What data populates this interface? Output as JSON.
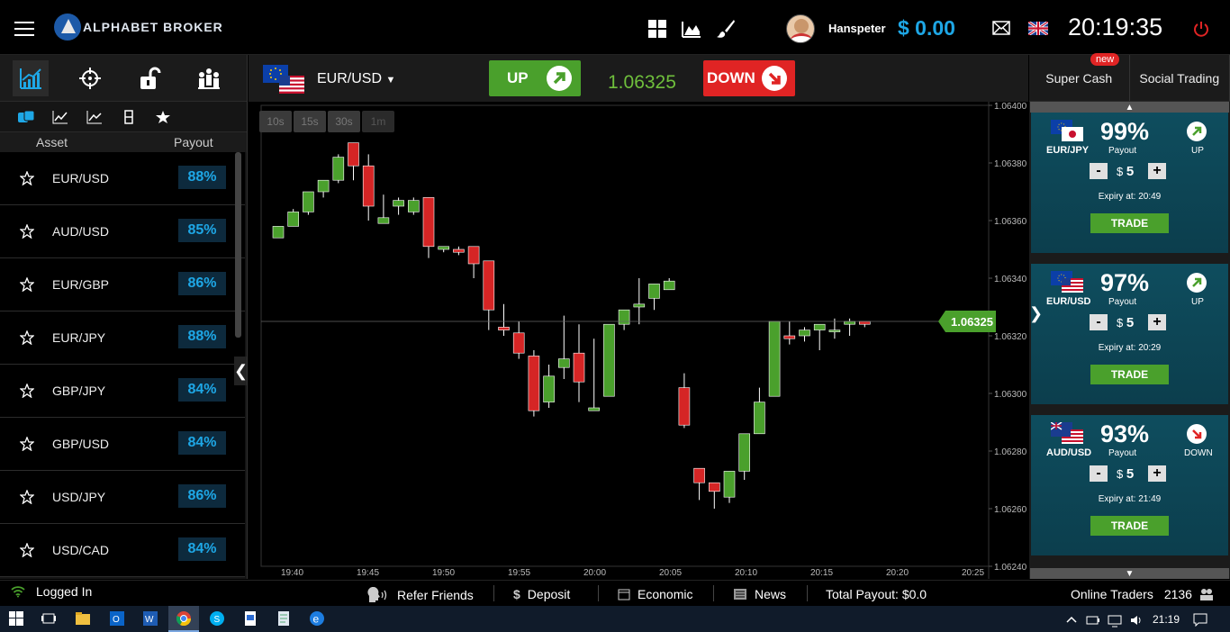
{
  "header": {
    "logo_text": "ALPHABET BROKER",
    "username": "Hanspeter",
    "balance": "$ 0.00",
    "clock": "20:19:35",
    "icons": [
      "menu-icon",
      "grid-icon",
      "area-chart-icon",
      "brush-icon",
      "mail-icon",
      "uk-flag-icon",
      "power-icon"
    ]
  },
  "left": {
    "col_asset": "Asset",
    "col_payout": "Payout",
    "assets": [
      {
        "name": "EUR/USD",
        "payout": "88%"
      },
      {
        "name": "AUD/USD",
        "payout": "85%"
      },
      {
        "name": "EUR/GBP",
        "payout": "86%"
      },
      {
        "name": "EUR/JPY",
        "payout": "88%"
      },
      {
        "name": "GBP/JPY",
        "payout": "84%"
      },
      {
        "name": "GBP/USD",
        "payout": "84%"
      },
      {
        "name": "USD/JPY",
        "payout": "86%"
      },
      {
        "name": "USD/CAD",
        "payout": "84%"
      }
    ],
    "collapse_glyph": "❮"
  },
  "center": {
    "pair": "EUR/USD",
    "up_label": "UP",
    "price": "1.06325",
    "down_label": "DOWN",
    "intervals": [
      "10s",
      "15s",
      "30s",
      "1m"
    ],
    "current_price_tag": "1.06325"
  },
  "right": {
    "tab_super": "Super Cash",
    "tab_new": "new",
    "tab_social": "Social Trading",
    "collapse_glyph": "❯",
    "cards": [
      {
        "pair": "EUR/JPY",
        "pct": "99%",
        "payout": "Payout",
        "dir": "UP",
        "amount": "5",
        "expiry": "Expiry at: 20:49",
        "trade": "TRADE",
        "color": "#4aa02c"
      },
      {
        "pair": "EUR/USD",
        "pct": "97%",
        "payout": "Payout",
        "dir": "UP",
        "amount": "5",
        "expiry": "Expiry at: 20:29",
        "trade": "TRADE",
        "color": "#4aa02c"
      },
      {
        "pair": "AUD/USD",
        "pct": "93%",
        "payout": "Payout",
        "dir": "DOWN",
        "amount": "5",
        "expiry": "Expiry at: 21:49",
        "trade": "TRADE",
        "color": "#e02424"
      }
    ]
  },
  "status": {
    "logged_in": "Logged In",
    "refer": "Refer Friends",
    "deposit": "Deposit",
    "economic": "Economic",
    "news": "News",
    "total_payout": "Total Payout: $0.0",
    "online_traders_label": "Online Traders",
    "online_traders_count": "2136"
  },
  "taskbar": {
    "time": "21:19"
  },
  "chart_data": {
    "type": "candlestick",
    "y_ticks": [
      "1.06400",
      "1.06380",
      "1.06360",
      "1.06340",
      "1.06320",
      "1.06300",
      "1.06280",
      "1.06260",
      "1.06240"
    ],
    "x_ticks": [
      "19:40",
      "19:45",
      "19:50",
      "19:55",
      "20:00",
      "20:05",
      "20:10",
      "20:15",
      "20:20",
      "20:25"
    ],
    "ylim": [
      1.0624,
      1.064
    ],
    "current_price": 1.06325,
    "candles": [
      [
        1.06354,
        1.06358,
        1.06354,
        1.06358
      ],
      [
        1.06358,
        1.06364,
        1.06358,
        1.06363
      ],
      [
        1.06363,
        1.0637,
        1.06362,
        1.0637
      ],
      [
        1.0637,
        1.06374,
        1.06368,
        1.06374
      ],
      [
        1.06374,
        1.06383,
        1.06373,
        1.06382
      ],
      [
        1.06387,
        1.06387,
        1.06374,
        1.06379
      ],
      [
        1.06379,
        1.06383,
        1.0636,
        1.06365
      ],
      [
        1.06359,
        1.06369,
        1.06359,
        1.06361
      ],
      [
        1.06365,
        1.06368,
        1.06362,
        1.06367
      ],
      [
        1.06363,
        1.06368,
        1.06362,
        1.06367
      ],
      [
        1.06368,
        1.06368,
        1.06347,
        1.06351
      ],
      [
        1.0635,
        1.06351,
        1.06349,
        1.06351
      ],
      [
        1.0635,
        1.06351,
        1.06348,
        1.06349
      ],
      [
        1.06351,
        1.06351,
        1.0634,
        1.06345
      ],
      [
        1.06346,
        1.06346,
        1.06322,
        1.06329
      ],
      [
        1.06323,
        1.06331,
        1.0632,
        1.06322
      ],
      [
        1.06321,
        1.06325,
        1.06312,
        1.06314
      ],
      [
        1.06313,
        1.06315,
        1.06292,
        1.06294
      ],
      [
        1.06297,
        1.0631,
        1.06295,
        1.06306
      ],
      [
        1.06309,
        1.06327,
        1.06305,
        1.06312
      ],
      [
        1.06314,
        1.06324,
        1.06297,
        1.06304
      ],
      [
        1.06294,
        1.06319,
        1.06294,
        1.06295
      ],
      [
        1.06299,
        1.06324,
        1.06299,
        1.06324
      ],
      [
        1.06324,
        1.06329,
        1.06322,
        1.06329
      ],
      [
        1.0633,
        1.0634,
        1.06324,
        1.06331
      ],
      [
        1.06333,
        1.06338,
        1.06329,
        1.06338
      ],
      [
        1.06336,
        1.0634,
        1.06336,
        1.06339
      ],
      [
        1.06302,
        1.06307,
        1.06288,
        1.06289
      ],
      [
        1.06274,
        1.06274,
        1.06263,
        1.06269
      ],
      [
        1.06269,
        1.06269,
        1.0626,
        1.06266
      ],
      [
        1.06264,
        1.06273,
        1.06262,
        1.06273
      ],
      [
        1.06273,
        1.06285,
        1.0627,
        1.06286
      ],
      [
        1.06286,
        1.06302,
        1.06286,
        1.06297
      ],
      [
        1.06299,
        1.06325,
        1.06299,
        1.06325
      ],
      [
        1.0632,
        1.06325,
        1.06317,
        1.06319
      ],
      [
        1.0632,
        1.06323,
        1.06318,
        1.06322
      ],
      [
        1.06322,
        1.06324,
        1.06315,
        1.06324
      ],
      [
        1.06322,
        1.06326,
        1.06319,
        1.06322
      ],
      [
        1.06324,
        1.06326,
        1.0632,
        1.06325
      ],
      [
        1.06325,
        1.06325,
        1.06323,
        1.06324
      ]
    ]
  }
}
